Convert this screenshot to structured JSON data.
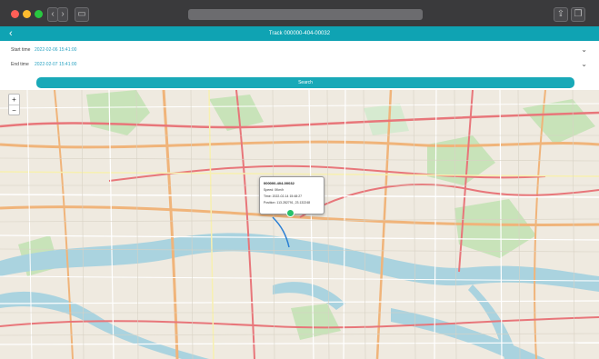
{
  "app": {
    "title": "Track 000000-404-00032",
    "colors": {
      "accent": "#0fa3b3",
      "date_text": "#2aa3c2",
      "marker": "#27c26b"
    }
  },
  "form": {
    "start_label": "Start time",
    "start_value": "2022-02-06 15:41:00",
    "end_label": "End time",
    "end_value": "2022-02-07 15:41:00",
    "search_label": "Search"
  },
  "map": {
    "zoom_in": "+",
    "zoom_out": "−",
    "popup": {
      "title": "000000-404-00032",
      "speed": "Speed: 0Km/h",
      "time": "Time: 2022-02-14 15:48:27",
      "position": "Position: 113.282791, 23.132248"
    }
  },
  "icons": [
    "back-arrow-icon",
    "chevron-down-icon",
    "map-marker-icon"
  ]
}
